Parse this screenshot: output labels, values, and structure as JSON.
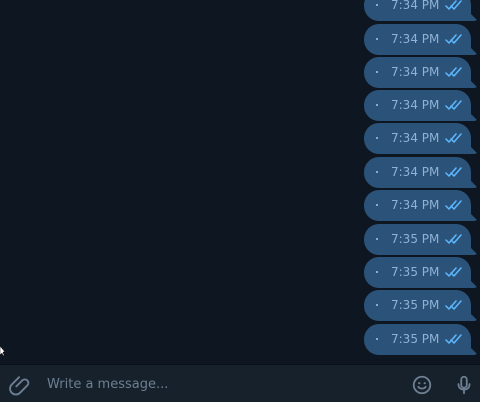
{
  "colors": {
    "background": "#0e1621",
    "bubble": "#2b5278",
    "composer": "#17212b",
    "muted_text": "#6d7f92",
    "time_text": "#8fb2d6"
  },
  "chat": {
    "messages": [
      {
        "time": "7:34 PM",
        "status_icon": "double-check-icon"
      },
      {
        "time": "7:34 PM",
        "status_icon": "double-check-icon"
      },
      {
        "time": "7:34 PM",
        "status_icon": "double-check-icon"
      },
      {
        "time": "7:34 PM",
        "status_icon": "double-check-icon"
      },
      {
        "time": "7:34 PM",
        "status_icon": "double-check-icon"
      },
      {
        "time": "7:34 PM",
        "status_icon": "double-check-icon"
      },
      {
        "time": "7:34 PM",
        "status_icon": "double-check-icon"
      },
      {
        "time": "7:35 PM",
        "status_icon": "double-check-icon"
      },
      {
        "time": "7:35 PM",
        "status_icon": "double-check-icon"
      },
      {
        "time": "7:35 PM",
        "status_icon": "double-check-icon"
      },
      {
        "time": "7:35 PM",
        "status_icon": "double-check-icon"
      }
    ]
  },
  "composer": {
    "placeholder": "Write a message...",
    "attach_icon": "paperclip-icon",
    "emoji_icon": "emoji-icon",
    "mic_icon": "microphone-icon"
  }
}
